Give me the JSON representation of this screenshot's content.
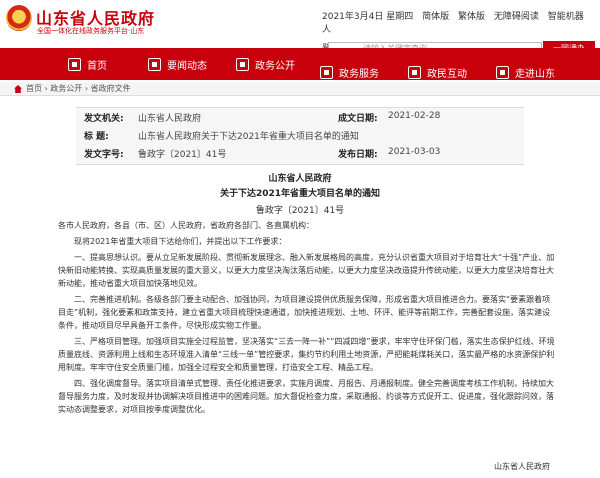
{
  "header": {
    "site_title": "山东省人民政府",
    "site_subtitle": "全国一体化在线政务服务平台·山东",
    "top_links": [
      "2021年3月4日 星期四",
      "简体版",
      "繁体版",
      "无障碍阅读",
      "智能机器人"
    ],
    "top_links2": [
      "登录",
      "注册"
    ],
    "search_placeholder": "请输入关键字查询",
    "search_button": "一网通办"
  },
  "nav": {
    "items": [
      "首页",
      "要闻动态",
      "政务公开",
      "政务服务",
      "政民互动",
      "走进山东"
    ]
  },
  "breadcrumb": "首页 › 政务公开 › 省政府文件",
  "info": {
    "issuer_label": "发文机关:",
    "issuer_value": "山东省人民政府",
    "date_label": "成文日期:",
    "date_value": "2021-02-28",
    "title_label": "标        题:",
    "title_value": "山东省人民政府关于下达2021年省重大项目名单的通知",
    "number_label": "发文字号:",
    "number_value": "鲁政字〔2021〕41号",
    "pub_label": "发布日期:",
    "pub_value": "2021-03-03"
  },
  "doc": {
    "issuer": "山东省人民政府",
    "title": "关于下达2021年省重大项目名单的通知",
    "number": "鲁政字〔2021〕41号",
    "salutation": "各市人民政府，各县（市、区）人民政府，省政府各部门、各直属机构：",
    "intro": "现将2021年省重大项目下达给你们，并提出以下工作要求：",
    "p1": "一、提高思想认识。要从立足新发展阶段、贯彻新发展理念、融入新发展格局的高度，充分认识省重大项目对于培育壮大“十强”产业、加快新旧动能转换、实现高质量发展的重大意义，以更大力度坚决淘汰落后动能，以更大力度坚决改造提升传统动能，以更大力度坚决培育壮大新动能，推动省重大项目加快落地见效。",
    "p2": "二、完善推进机制。各级各部门要主动配合、加强协同，为项目建设提供优质服务保障，形成省重大项目推进合力。要落实“要素跟着项目走”机制，强化要素和政策支持，建立省重大项目梳理快速通道，加快推进规划、土地、环评、能评等前期工作，完善配套设施，落实建设条件，推动项目尽早具备开工条件，尽快形成实物工作量。",
    "p3": "三、严格项目管理。加强项目实施全过程监管，坚决落实“三去一降一补”“四减四增”要求，牢牢守住环保门槛，落实生态保护红线、环境质量底线、资源利用上线和生态环境准入清单“三线一单”管控要求，集约节约利用土地资源，严把能耗煤耗关口，落实最严格的水资源保护利用制度。牢牢守住安全质量门槛，加强全过程安全和质量管理，打造安全工程、精品工程。",
    "p4": "四、强化调度督导。落实项目清单式管理、责任化推进要求，实施月调度、月报告、月通报制度。健全完善调度考核工作机制，持续加大督导服务力度，及时发现并协调解决项目推进中的困难问题。加大督促检查力度，采取通报、约谈等方式促开工、促进度，强化跟踪问效，落实动态调整要求，对项目按季度调整优化。",
    "sign": "山东省人民政府"
  },
  "colors": {
    "brand_red": "#c7000b"
  }
}
